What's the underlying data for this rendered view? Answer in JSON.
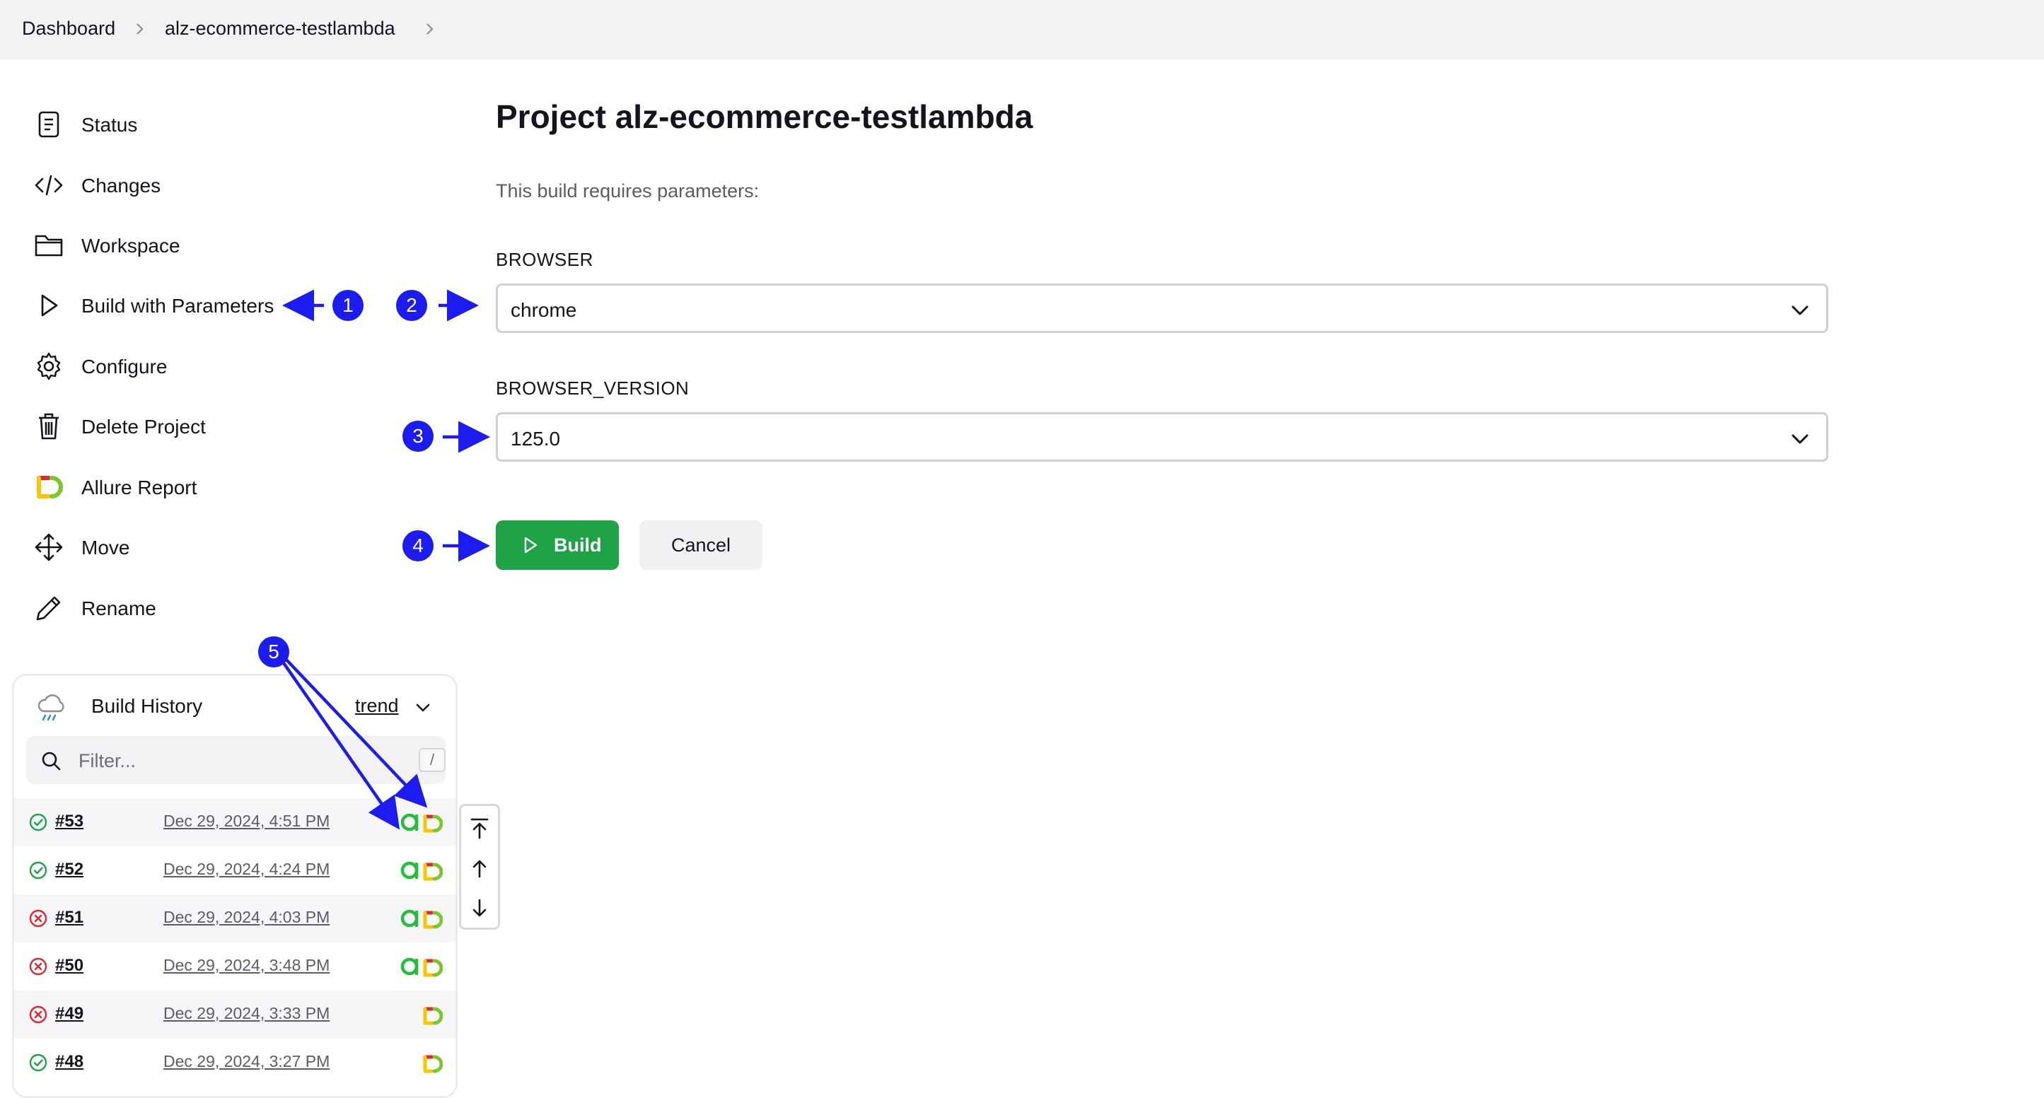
{
  "breadcrumb": {
    "items": [
      "Dashboard",
      "alz-ecommerce-testlambda"
    ]
  },
  "sidebar": {
    "items": [
      {
        "label": "Status",
        "icon": "status-icon"
      },
      {
        "label": "Changes",
        "icon": "code-icon"
      },
      {
        "label": "Workspace",
        "icon": "folder-icon"
      },
      {
        "label": "Build with Parameters",
        "icon": "play-icon"
      },
      {
        "label": "Configure",
        "icon": "gear-icon"
      },
      {
        "label": "Delete Project",
        "icon": "trash-icon"
      },
      {
        "label": "Allure Report",
        "icon": "allure-icon"
      },
      {
        "label": "Move",
        "icon": "move-icon"
      },
      {
        "label": "Rename",
        "icon": "pencil-icon"
      }
    ]
  },
  "main": {
    "title": "Project alz-ecommerce-testlambda",
    "subtitle": "This build requires parameters:",
    "params": [
      {
        "name": "BROWSER",
        "value": "chrome"
      },
      {
        "name": "BROWSER_VERSION",
        "value": "125.0"
      }
    ],
    "build_label": "Build",
    "cancel_label": "Cancel"
  },
  "history": {
    "title": "Build History",
    "trend_label": "trend",
    "filter_placeholder": "Filter...",
    "filter_shortcut": "/",
    "builds": [
      {
        "number": "#53",
        "date": "Dec 29, 2024, 4:51 PM",
        "status": "success",
        "has_agent": true
      },
      {
        "number": "#52",
        "date": "Dec 29, 2024, 4:24 PM",
        "status": "success",
        "has_agent": true
      },
      {
        "number": "#51",
        "date": "Dec 29, 2024, 4:03 PM",
        "status": "failed",
        "has_agent": true
      },
      {
        "number": "#50",
        "date": "Dec 29, 2024, 3:48 PM",
        "status": "failed",
        "has_agent": true
      },
      {
        "number": "#49",
        "date": "Dec 29, 2024, 3:33 PM",
        "status": "failed",
        "has_agent": false
      },
      {
        "number": "#48",
        "date": "Dec 29, 2024, 3:27 PM",
        "status": "success",
        "has_agent": false
      }
    ]
  },
  "annotations": [
    "1",
    "2",
    "3",
    "4",
    "5"
  ],
  "colors": {
    "accent_green": "#1ea446",
    "annotation_blue": "#1c1cf0",
    "success": "#1ea446",
    "failure": "#e0282d"
  }
}
